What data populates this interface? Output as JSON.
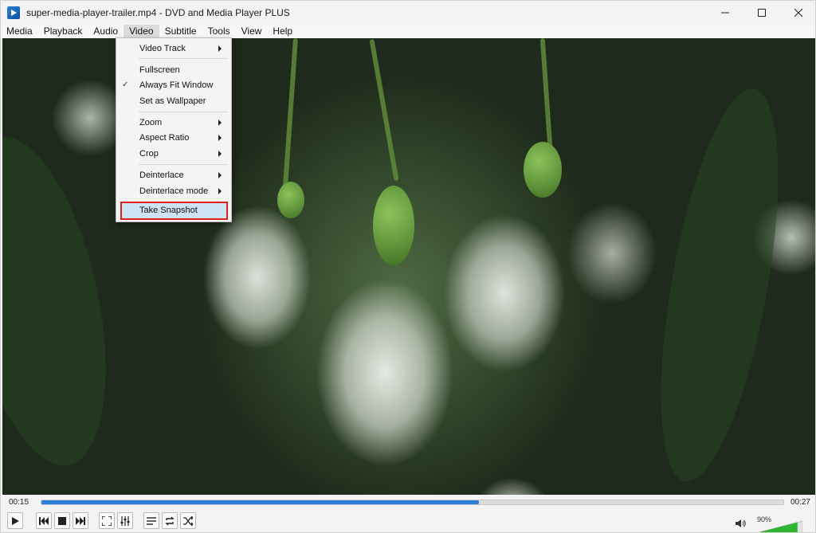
{
  "window": {
    "title": "super-media-player-trailer.mp4 - DVD and Media Player PLUS",
    "controls": {
      "minimize_icon": "minimize-icon",
      "maximize_icon": "maximize-icon",
      "close_icon": "close-icon"
    }
  },
  "menubar": {
    "items": [
      {
        "label": "Media"
      },
      {
        "label": "Playback"
      },
      {
        "label": "Audio"
      },
      {
        "label": "Video"
      },
      {
        "label": "Subtitle"
      },
      {
        "label": "Tools"
      },
      {
        "label": "View"
      },
      {
        "label": "Help"
      }
    ],
    "active": "Video"
  },
  "video_menu": {
    "items": [
      {
        "label": "Video Track",
        "submenu": true,
        "checked": false
      },
      {
        "label": "Fullscreen",
        "submenu": false,
        "checked": false
      },
      {
        "label": "Always Fit Window",
        "submenu": false,
        "checked": true
      },
      {
        "label": "Set as Wallpaper",
        "submenu": false,
        "checked": false
      },
      {
        "label": "Zoom",
        "submenu": true,
        "checked": false
      },
      {
        "label": "Aspect Ratio",
        "submenu": true,
        "checked": false
      },
      {
        "label": "Crop",
        "submenu": true,
        "checked": false
      },
      {
        "label": "Deinterlace",
        "submenu": true,
        "checked": false
      },
      {
        "label": "Deinterlace mode",
        "submenu": true,
        "checked": false
      },
      {
        "label": "Take Snapshot",
        "submenu": false,
        "checked": false,
        "highlighted": true
      }
    ],
    "check_glyph": "✓",
    "highlight_border_color": "#e0201a"
  },
  "playback": {
    "elapsed": "00:15",
    "duration": "00:27",
    "progress_fraction": 0.59,
    "accent_color": "#2f7ed8"
  },
  "controls": {
    "buttons": [
      {
        "icon": "play-icon"
      },
      {
        "icon": "previous-icon"
      },
      {
        "icon": "stop-icon"
      },
      {
        "icon": "next-icon"
      },
      {
        "icon": "fullscreen-icon"
      },
      {
        "icon": "equalizer-icon"
      },
      {
        "icon": "playlist-icon"
      },
      {
        "icon": "loop-icon"
      },
      {
        "icon": "shuffle-icon"
      }
    ],
    "volume_icon": "speaker-icon",
    "volume_percent": "90%",
    "volume_fraction": 0.9,
    "volume_color": "#2fb52f"
  }
}
